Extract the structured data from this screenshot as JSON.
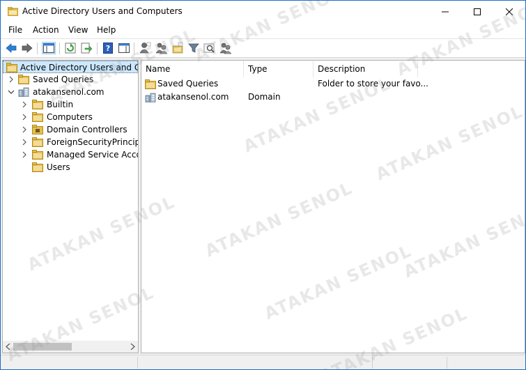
{
  "window": {
    "title": "Active Directory Users and Computers"
  },
  "menu": [
    "File",
    "Action",
    "View",
    "Help"
  ],
  "tree": {
    "root_label": "Active Directory Users and Com",
    "items": [
      {
        "label": "Saved Queries"
      },
      {
        "label": "atakansenol.com"
      },
      {
        "label": "Builtin"
      },
      {
        "label": "Computers"
      },
      {
        "label": "Domain Controllers"
      },
      {
        "label": "ForeignSecurityPrincipals"
      },
      {
        "label": "Managed Service Accounts"
      },
      {
        "label": "Users"
      }
    ]
  },
  "list": {
    "columns": [
      "Name",
      "Type",
      "Description"
    ],
    "rows": [
      {
        "name": "Saved Queries",
        "type": "",
        "description": "Folder to store your favo..."
      },
      {
        "name": "atakansenol.com",
        "type": "Domain",
        "description": ""
      }
    ]
  },
  "watermark": "ATAKAN SENOL",
  "colors": {
    "accent": "#1a6fc9",
    "selection": "#cce8ff",
    "folder": "#e8c04a"
  }
}
